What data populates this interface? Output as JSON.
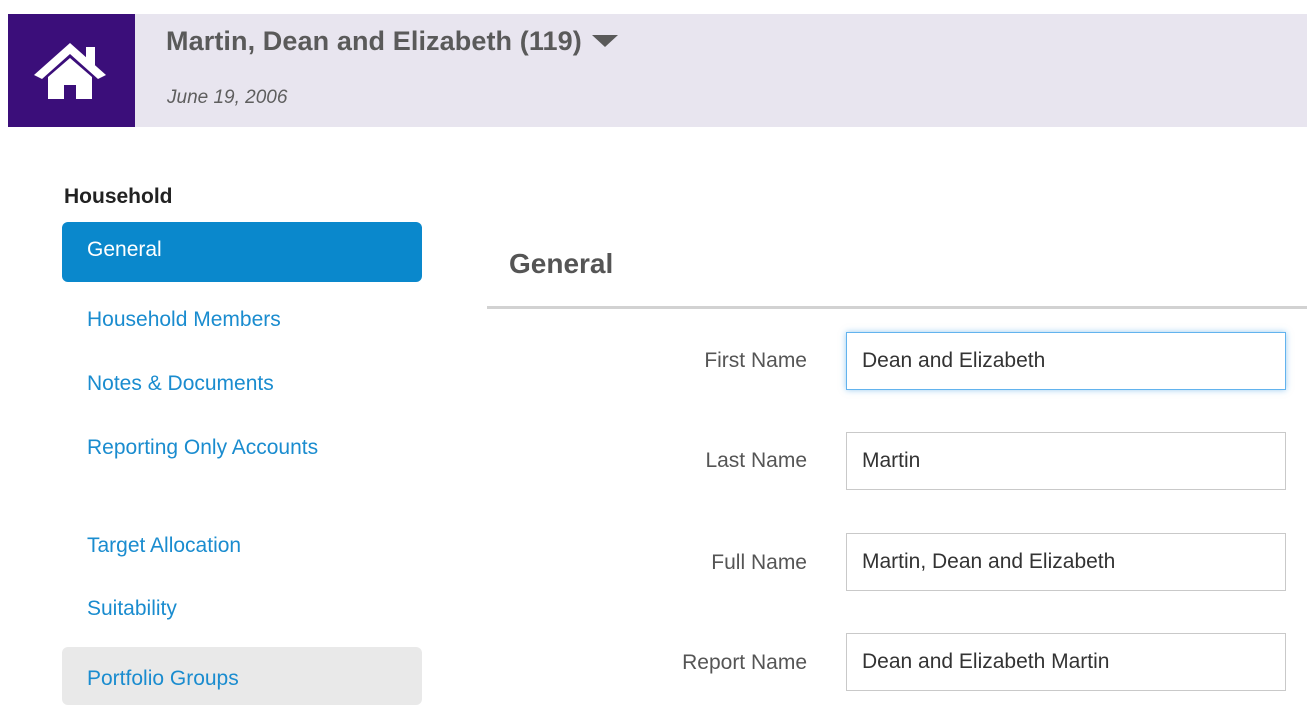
{
  "header": {
    "household_title": "Martin, Dean and Elizabeth (119)",
    "date": "June 19, 2006",
    "home_icon": "home-icon",
    "dropdown_icon": "caret-down-icon",
    "brand_color": "#3b0e7a",
    "header_bg": "#e8e5ef"
  },
  "sidebar": {
    "heading": "Household",
    "items": [
      {
        "label": "General",
        "state": "active"
      },
      {
        "label": "Household Members"
      },
      {
        "label": "Notes & Documents"
      },
      {
        "label": "Reporting Only Accounts"
      },
      {
        "label": "Target Allocation"
      },
      {
        "label": "Suitability"
      },
      {
        "label": "Portfolio Groups",
        "state": "hover"
      }
    ],
    "active_color": "#0a88cc",
    "link_color": "#1a8ccf"
  },
  "main": {
    "section_title": "General",
    "fields": [
      {
        "label": "First Name",
        "value": "Dean and Elizabeth",
        "focused": true
      },
      {
        "label": "Last Name",
        "value": "Martin"
      },
      {
        "label": "Full Name",
        "value": "Martin, Dean and Elizabeth"
      },
      {
        "label": "Report Name",
        "value": "Dean and Elizabeth Martin"
      }
    ]
  }
}
